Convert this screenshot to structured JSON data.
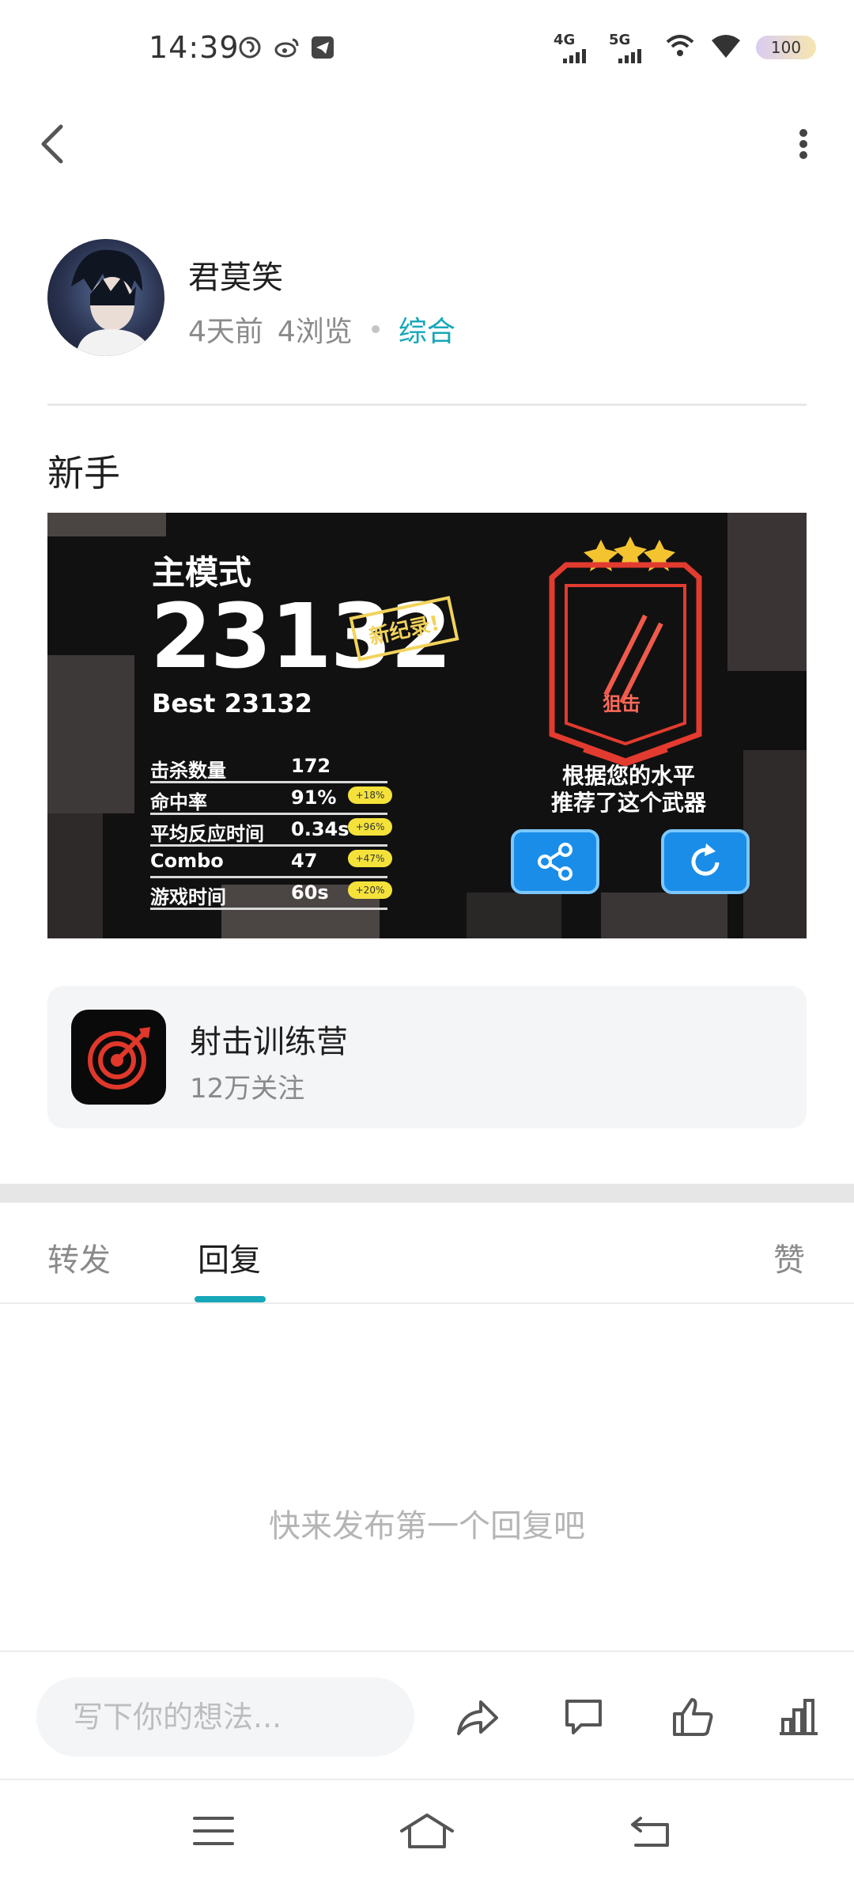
{
  "status_bar": {
    "time": "14:39",
    "signal_1_label": "4G",
    "signal_2_label": "5G",
    "battery": "100"
  },
  "author": {
    "name": "君莫笑",
    "time_ago": "4天前",
    "views": "4浏览",
    "category": "综合"
  },
  "post": {
    "title": "新手"
  },
  "game_screenshot": {
    "mode": "主模式",
    "score": "23132",
    "record_badge": "新纪录!",
    "best": "Best 23132",
    "stats": [
      {
        "label": "击杀数量",
        "value": "172",
        "bonus": ""
      },
      {
        "label": "命中率",
        "value": "91%",
        "bonus": "+18%"
      },
      {
        "label": "平均反应时间",
        "value": "0.34s",
        "bonus": "+96%"
      },
      {
        "label": "Combo",
        "value": "47",
        "bonus": "+47%"
      },
      {
        "label": "游戏时间",
        "value": "60s",
        "bonus": "+20%"
      }
    ],
    "emblem_label": "狙击",
    "recommend_line_1": "根据您的水平",
    "recommend_line_2": "推荐了这个武器"
  },
  "community": {
    "name": "射击训练营",
    "followers": "12万关注"
  },
  "tabs": {
    "forward": "转发",
    "reply": "回复",
    "like": "赞"
  },
  "empty_hint": "快来发布第一个回复吧",
  "action_bar": {
    "input_placeholder": "写下你的想法..."
  },
  "colors": {
    "accent": "#16a7b8",
    "meta_gray": "#8a8a8a",
    "card_bg": "#f4f5f7"
  }
}
